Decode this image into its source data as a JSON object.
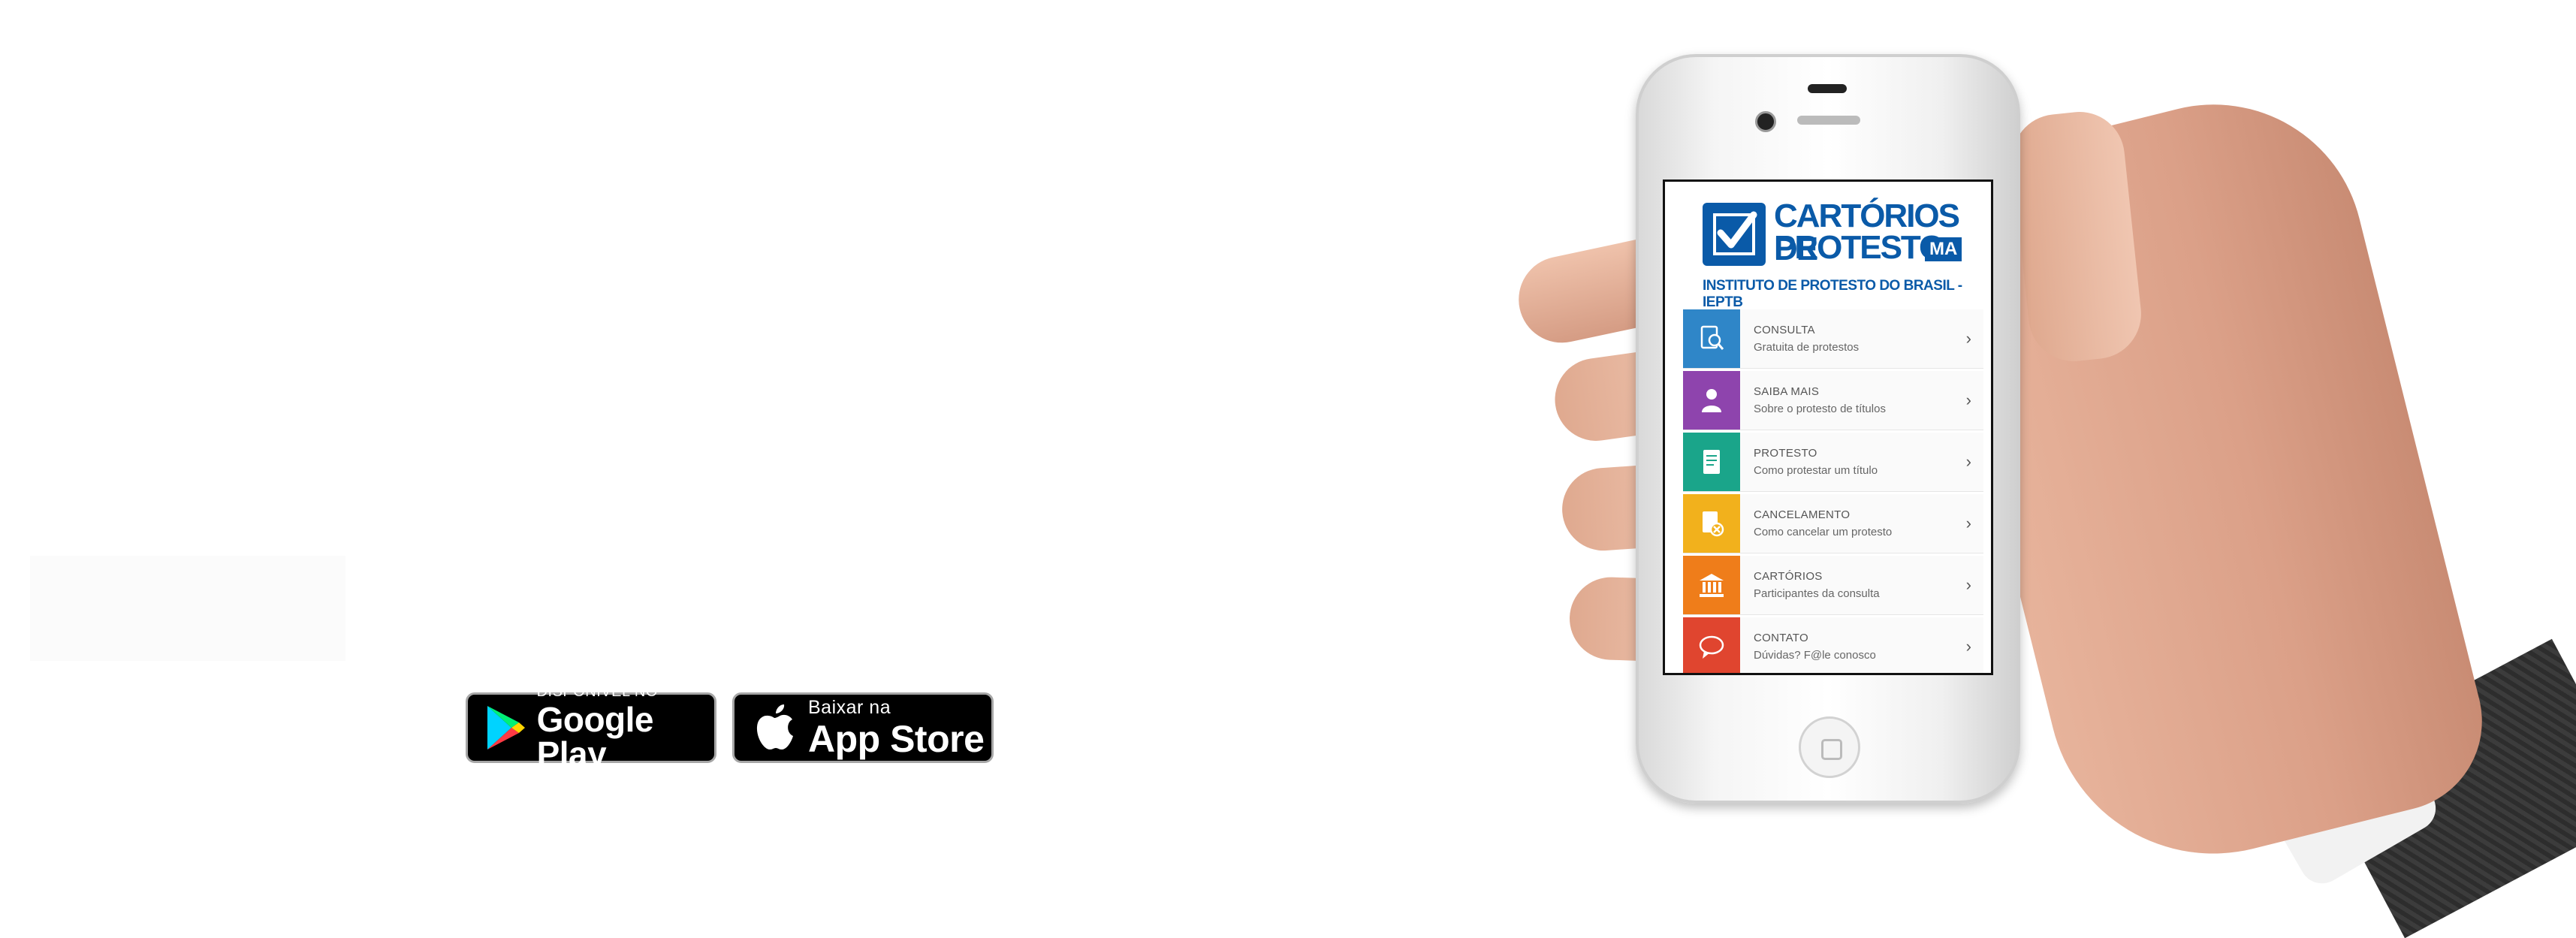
{
  "colors": {
    "brand_blue": "#0a5aa8",
    "consulta": "#2f86c8",
    "saiba_mais": "#8e44ad",
    "protesto": "#1aa58a",
    "cancelamento": "#f2b11c",
    "cartorios": "#ef7d1a",
    "contato": "#e0452f"
  },
  "badges": {
    "google_play": {
      "small": "DISPONÍVEL NO",
      "big": "Google Play"
    },
    "app_store": {
      "small": "Baixar na",
      "big": "App Store"
    }
  },
  "app": {
    "logo_line1": "CARTÓRIOS DE",
    "logo_line2": "PROTESTO",
    "logo_badge": "MA",
    "logo_sub": "INSTITUTO DE PROTESTO DO BRASIL - IEPTB",
    "menu": [
      {
        "title": "CONSULTA",
        "subtitle": "Gratuita de protestos",
        "icon": "search-document-icon"
      },
      {
        "title": "SAIBA MAIS",
        "subtitle": "Sobre o protesto de títulos",
        "icon": "person-info-icon"
      },
      {
        "title": "PROTESTO",
        "subtitle": "Como protestar um título",
        "icon": "document-icon"
      },
      {
        "title": "CANCELAMENTO",
        "subtitle": "Como cancelar um protesto",
        "icon": "document-cancel-icon"
      },
      {
        "title": "CARTÓRIOS",
        "subtitle": "Participantes da consulta",
        "icon": "building-icon"
      },
      {
        "title": "CONTATO",
        "subtitle": "Dúvidas? F@le conosco",
        "icon": "speech-bubble-icon"
      }
    ]
  }
}
